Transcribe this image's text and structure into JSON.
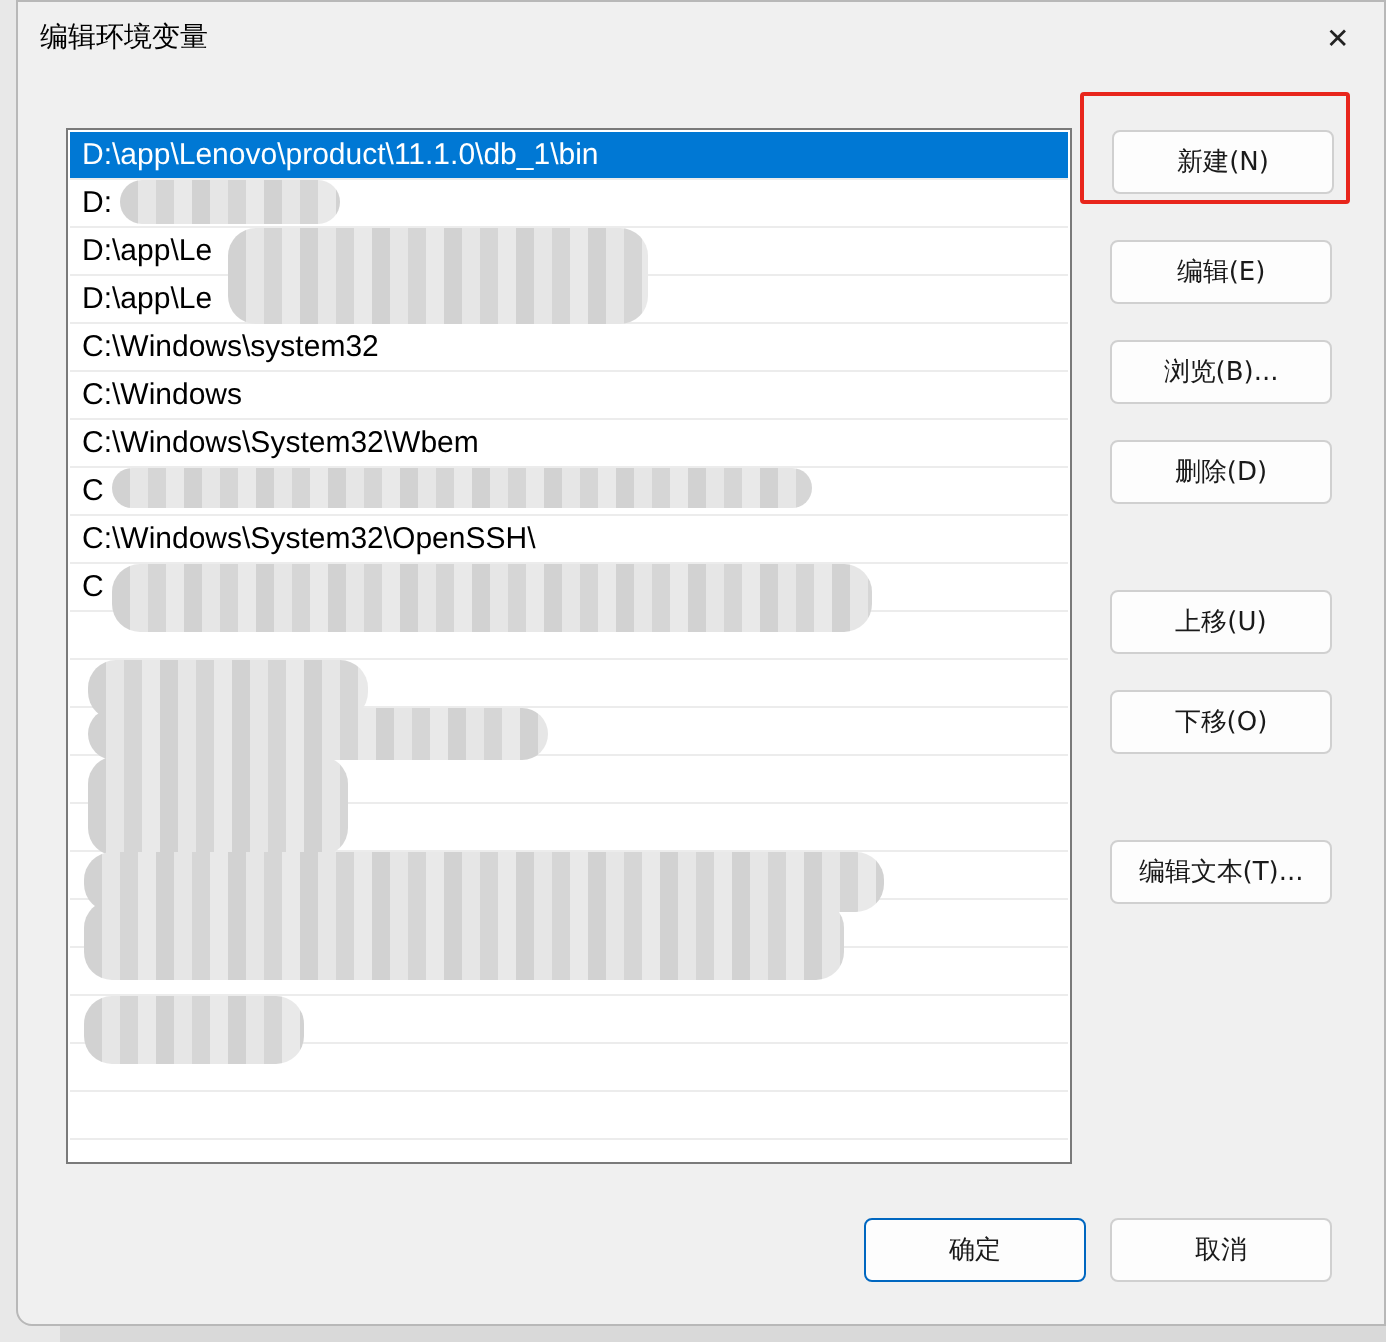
{
  "window": {
    "title": "编辑环境变量",
    "close": "✕"
  },
  "paths": [
    {
      "text": "D:\\app\\Lenovo\\product\\11.1.0\\db_1\\bin",
      "selected": true
    },
    {
      "text": "D:",
      "selected": false
    },
    {
      "text": "D:\\app\\Le",
      "selected": false
    },
    {
      "text": "D:\\app\\Le",
      "selected": false
    },
    {
      "text": "C:\\Windows\\system32",
      "selected": false
    },
    {
      "text": "C:\\Windows",
      "selected": false
    },
    {
      "text": "C:\\Windows\\System32\\Wbem",
      "selected": false
    },
    {
      "text": "C",
      "selected": false
    },
    {
      "text": "C:\\Windows\\System32\\OpenSSH\\",
      "selected": false
    },
    {
      "text": "C",
      "selected": false
    }
  ],
  "button_groups": [
    {
      "buttons": [
        {
          "label": "新建(N)",
          "highlighted": true
        },
        {
          "label": "编辑(E)",
          "highlighted": false
        },
        {
          "label": "浏览(B)...",
          "highlighted": false
        },
        {
          "label": "删除(D)",
          "highlighted": false
        }
      ]
    },
    {
      "buttons": [
        {
          "label": "上移(U)",
          "highlighted": false
        },
        {
          "label": "下移(O)",
          "highlighted": false
        }
      ]
    },
    {
      "buttons": [
        {
          "label": "编辑文本(T)...",
          "highlighted": false
        }
      ]
    }
  ],
  "footer": [
    {
      "label": "确定",
      "default": true
    },
    {
      "label": "取消",
      "default": false
    }
  ]
}
